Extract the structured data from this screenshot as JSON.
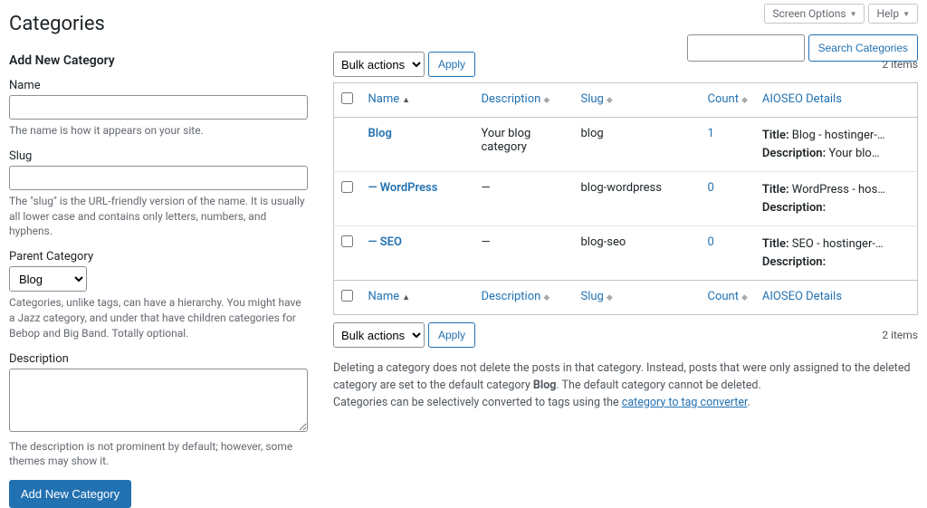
{
  "top": {
    "screen_options": "Screen Options",
    "help": "Help"
  },
  "page_title": "Categories",
  "search": {
    "button": "Search Categories"
  },
  "form": {
    "heading": "Add New Category",
    "name_label": "Name",
    "name_hint": "The name is how it appears on your site.",
    "slug_label": "Slug",
    "slug_hint": "The \"slug\" is the URL-friendly version of the name. It is usually all lower case and contains only letters, numbers, and hyphens.",
    "parent_label": "Parent Category",
    "parent_value": "Blog",
    "parent_hint": "Categories, unlike tags, can have a hierarchy. You might have a Jazz category, and under that have children categories for Bebop and Big Band. Totally optional.",
    "desc_label": "Description",
    "desc_hint": "The description is not prominent by default; however, some themes may show it.",
    "submit": "Add New Category"
  },
  "list": {
    "bulk_label": "Bulk actions",
    "apply": "Apply",
    "items_text": "2 items",
    "cols": {
      "name": "Name",
      "description": "Description",
      "slug": "Slug",
      "count": "Count",
      "aioseo": "AIOSEO Details"
    },
    "rows": [
      {
        "indent": false,
        "name": "Blog",
        "description": "Your blog category",
        "slug": "blog",
        "count": "1",
        "aioseo_title": "Blog - hostinger-…",
        "aioseo_desc": "Your blo…",
        "no_checkbox": true
      },
      {
        "indent": true,
        "name": "WordPress",
        "description": "—",
        "slug": "blog-wordpress",
        "count": "0",
        "aioseo_title": "WordPress - hos…",
        "aioseo_desc": ""
      },
      {
        "indent": true,
        "name": "SEO",
        "description": "—",
        "slug": "blog-seo",
        "count": "0",
        "aioseo_title": "SEO - hostinger-…",
        "aioseo_desc": ""
      }
    ]
  },
  "notes": {
    "l1a": "Deleting a category does not delete the posts in that category. Instead, posts that were only assigned to the deleted category are set to the default category ",
    "l1b": "Blog",
    "l1c": ". The default category cannot be deleted.",
    "l2a": "Categories can be selectively converted to tags using the ",
    "l2b": "category to tag converter",
    "l2c": "."
  }
}
